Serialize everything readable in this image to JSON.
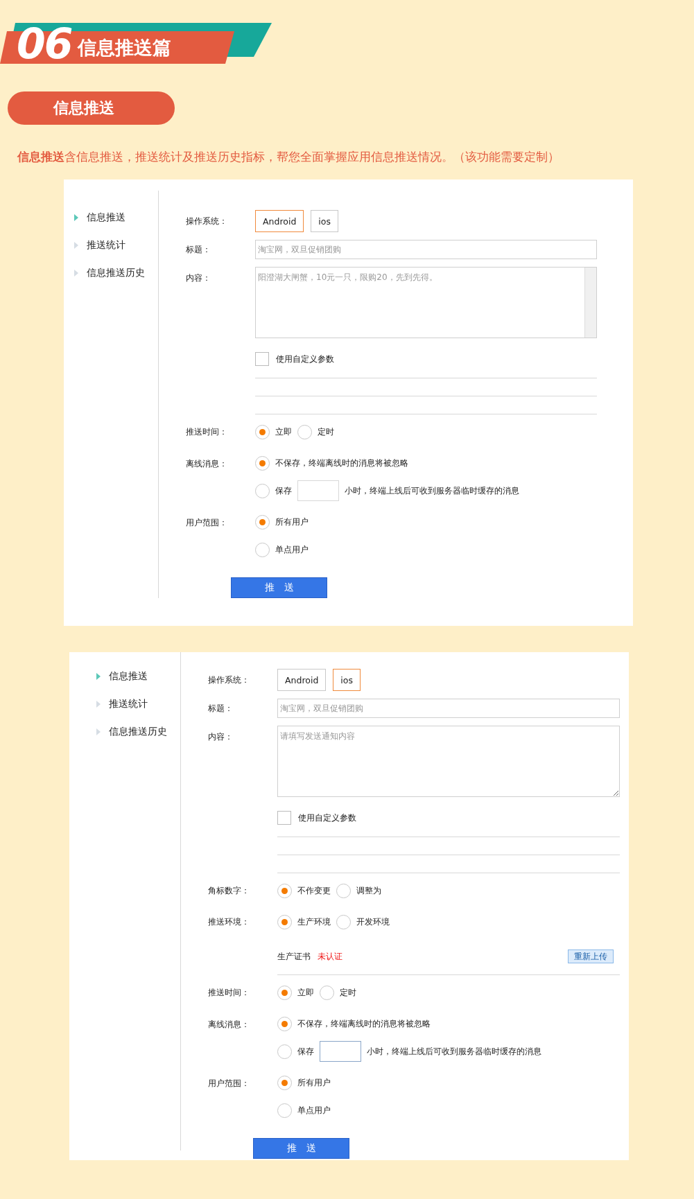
{
  "banner": {
    "number": "06",
    "title": "信息推送篇"
  },
  "section_pill": "信息推送",
  "description": "**信息推送**含信息推送，推送统计及推送历史指标，帮您全面掌握应用信息推送情况。（该功能需要定制）",
  "panels": [
    {
      "sidebar": [
        {
          "label": "信息推送",
          "selected": true
        },
        {
          "label": "推送统计",
          "selected": false
        },
        {
          "label": "信息推送历史",
          "selected": false
        }
      ],
      "os": {
        "label": "操作系统：",
        "options": [
          {
            "label": "Android",
            "selected": true
          },
          {
            "label": "ios",
            "selected": false
          }
        ]
      },
      "title_field": {
        "label": "标题：",
        "placeholder": "淘宝网，双旦促销团购"
      },
      "content_field": {
        "label": "内容：",
        "placeholder": "阳澄湖大闸蟹，10元一只，限购20，先到先得。",
        "scrollbar": true
      },
      "custom_params": {
        "label": "使用自定义参数",
        "checked": false
      },
      "settings": [
        {
          "kind": "inline",
          "label": "推送时间：",
          "options": [
            {
              "label": "立即",
              "selected": true
            },
            {
              "label": "定时",
              "selected": false
            }
          ]
        },
        {
          "kind": "stacked",
          "label": "离线消息：",
          "options": [
            {
              "label": "不保存，终端离线时的消息将被忽略",
              "selected": true
            },
            {
              "label": "保存",
              "selected": false,
              "hours_field": {
                "focused": false
              },
              "suffix": "小时，终端上线后可收到服务器临时缓存的消息"
            }
          ]
        },
        {
          "kind": "stacked",
          "label": "用户范围：",
          "options": [
            {
              "label": "所有用户",
              "selected": true
            },
            {
              "label": "单点用户",
              "selected": false
            }
          ]
        }
      ],
      "submit": "推　送"
    },
    {
      "sidebar": [
        {
          "label": "信息推送",
          "selected": true
        },
        {
          "label": "推送统计",
          "selected": false
        },
        {
          "label": "信息推送历史",
          "selected": false
        }
      ],
      "os": {
        "label": "操作系统：",
        "options": [
          {
            "label": "Android",
            "selected": false
          },
          {
            "label": "ios",
            "selected": true
          }
        ]
      },
      "title_field": {
        "label": "标题：",
        "placeholder": "淘宝网，双旦促销团购"
      },
      "content_field": {
        "label": "内容：",
        "placeholder": "请填写发送通知内容",
        "scrollbar": false
      },
      "custom_params": {
        "label": "使用自定义参数",
        "checked": false
      },
      "settings": [
        {
          "kind": "inline",
          "label": "角标数字：",
          "options": [
            {
              "label": "不作变更",
              "selected": true
            },
            {
              "label": "调整为",
              "selected": false
            }
          ]
        },
        {
          "kind": "inline",
          "label": "推送环境：",
          "options": [
            {
              "label": "生产环境",
              "selected": true
            },
            {
              "label": "开发环境",
              "selected": false
            }
          ]
        },
        {
          "kind": "cert",
          "label": "生产证书",
          "status": "未认证",
          "button": "重新上传"
        },
        {
          "kind": "inline",
          "label": "推送时间：",
          "options": [
            {
              "label": "立即",
              "selected": true
            },
            {
              "label": "定时",
              "selected": false
            }
          ]
        },
        {
          "kind": "stacked",
          "label": "离线消息：",
          "options": [
            {
              "label": "不保存，终端离线时的消息将被忽略",
              "selected": true
            },
            {
              "label": "保存",
              "selected": false,
              "hours_field": {
                "focused": true
              },
              "suffix": "小时，终端上线后可收到服务器临时缓存的消息"
            }
          ]
        },
        {
          "kind": "stacked",
          "label": "用户范围：",
          "options": [
            {
              "label": "所有用户",
              "selected": true
            },
            {
              "label": "单点用户",
              "selected": false
            }
          ]
        }
      ],
      "submit": "推　送"
    }
  ]
}
